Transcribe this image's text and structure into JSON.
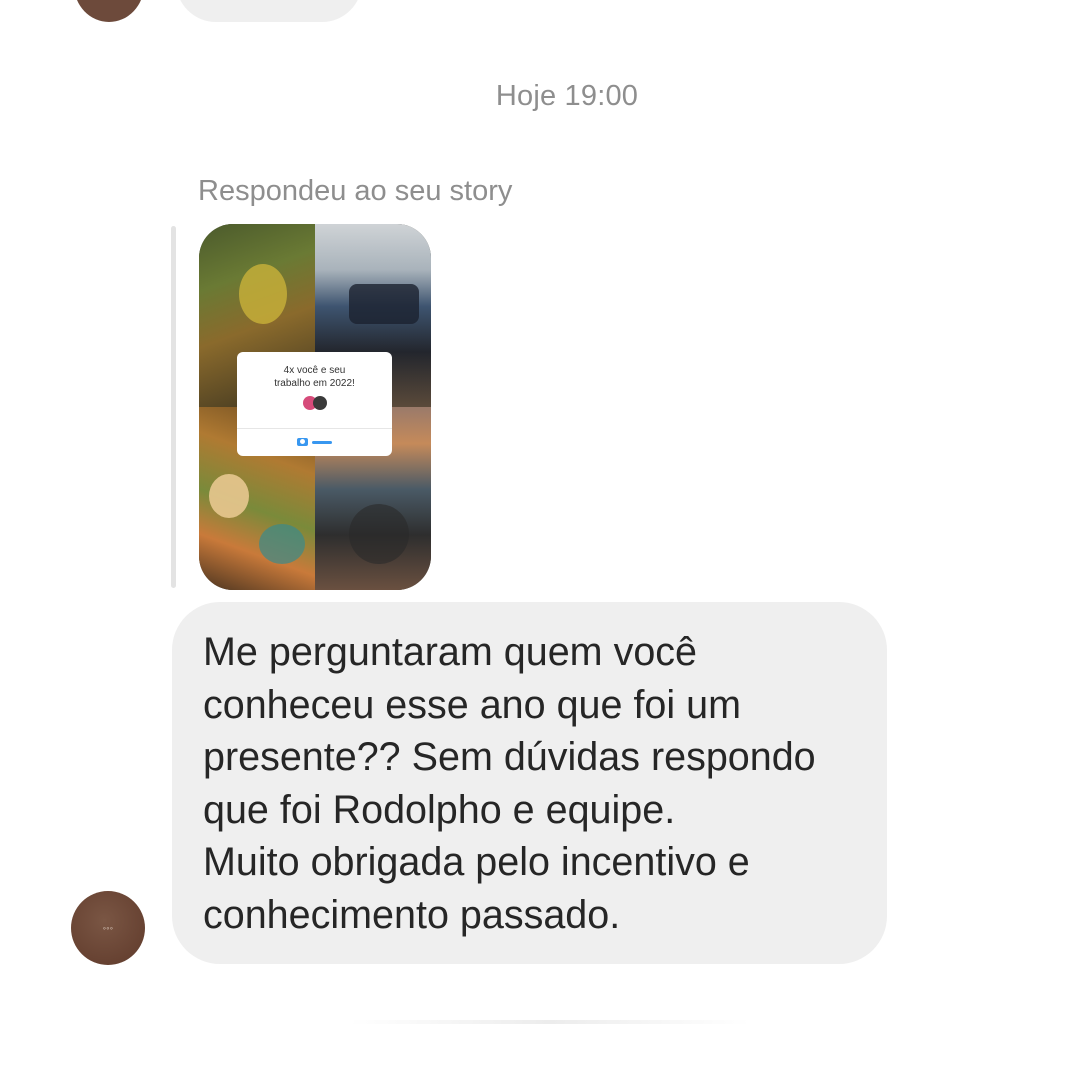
{
  "conversation": {
    "timestamp": "Hoje 19:00",
    "reply_label": "Respondeu ao seu story",
    "story": {
      "card_text_line1": "4x você e seu",
      "card_text_line2": "trabalho em 2022!"
    },
    "message": {
      "lines": [
        "Me perguntaram quem você",
        "conheceu esse ano que foi um",
        "presente?? Sem dúvidas respondo",
        "que foi Rodolpho e equipe.",
        "Muito obrigada pelo incentivo e",
        "conhecimento passado."
      ]
    }
  },
  "colors": {
    "background": "#ffffff",
    "bubble": "#efefef",
    "meta_text": "#8e8e8e",
    "message_text": "#262626",
    "avatar": "#6d4a3b"
  }
}
